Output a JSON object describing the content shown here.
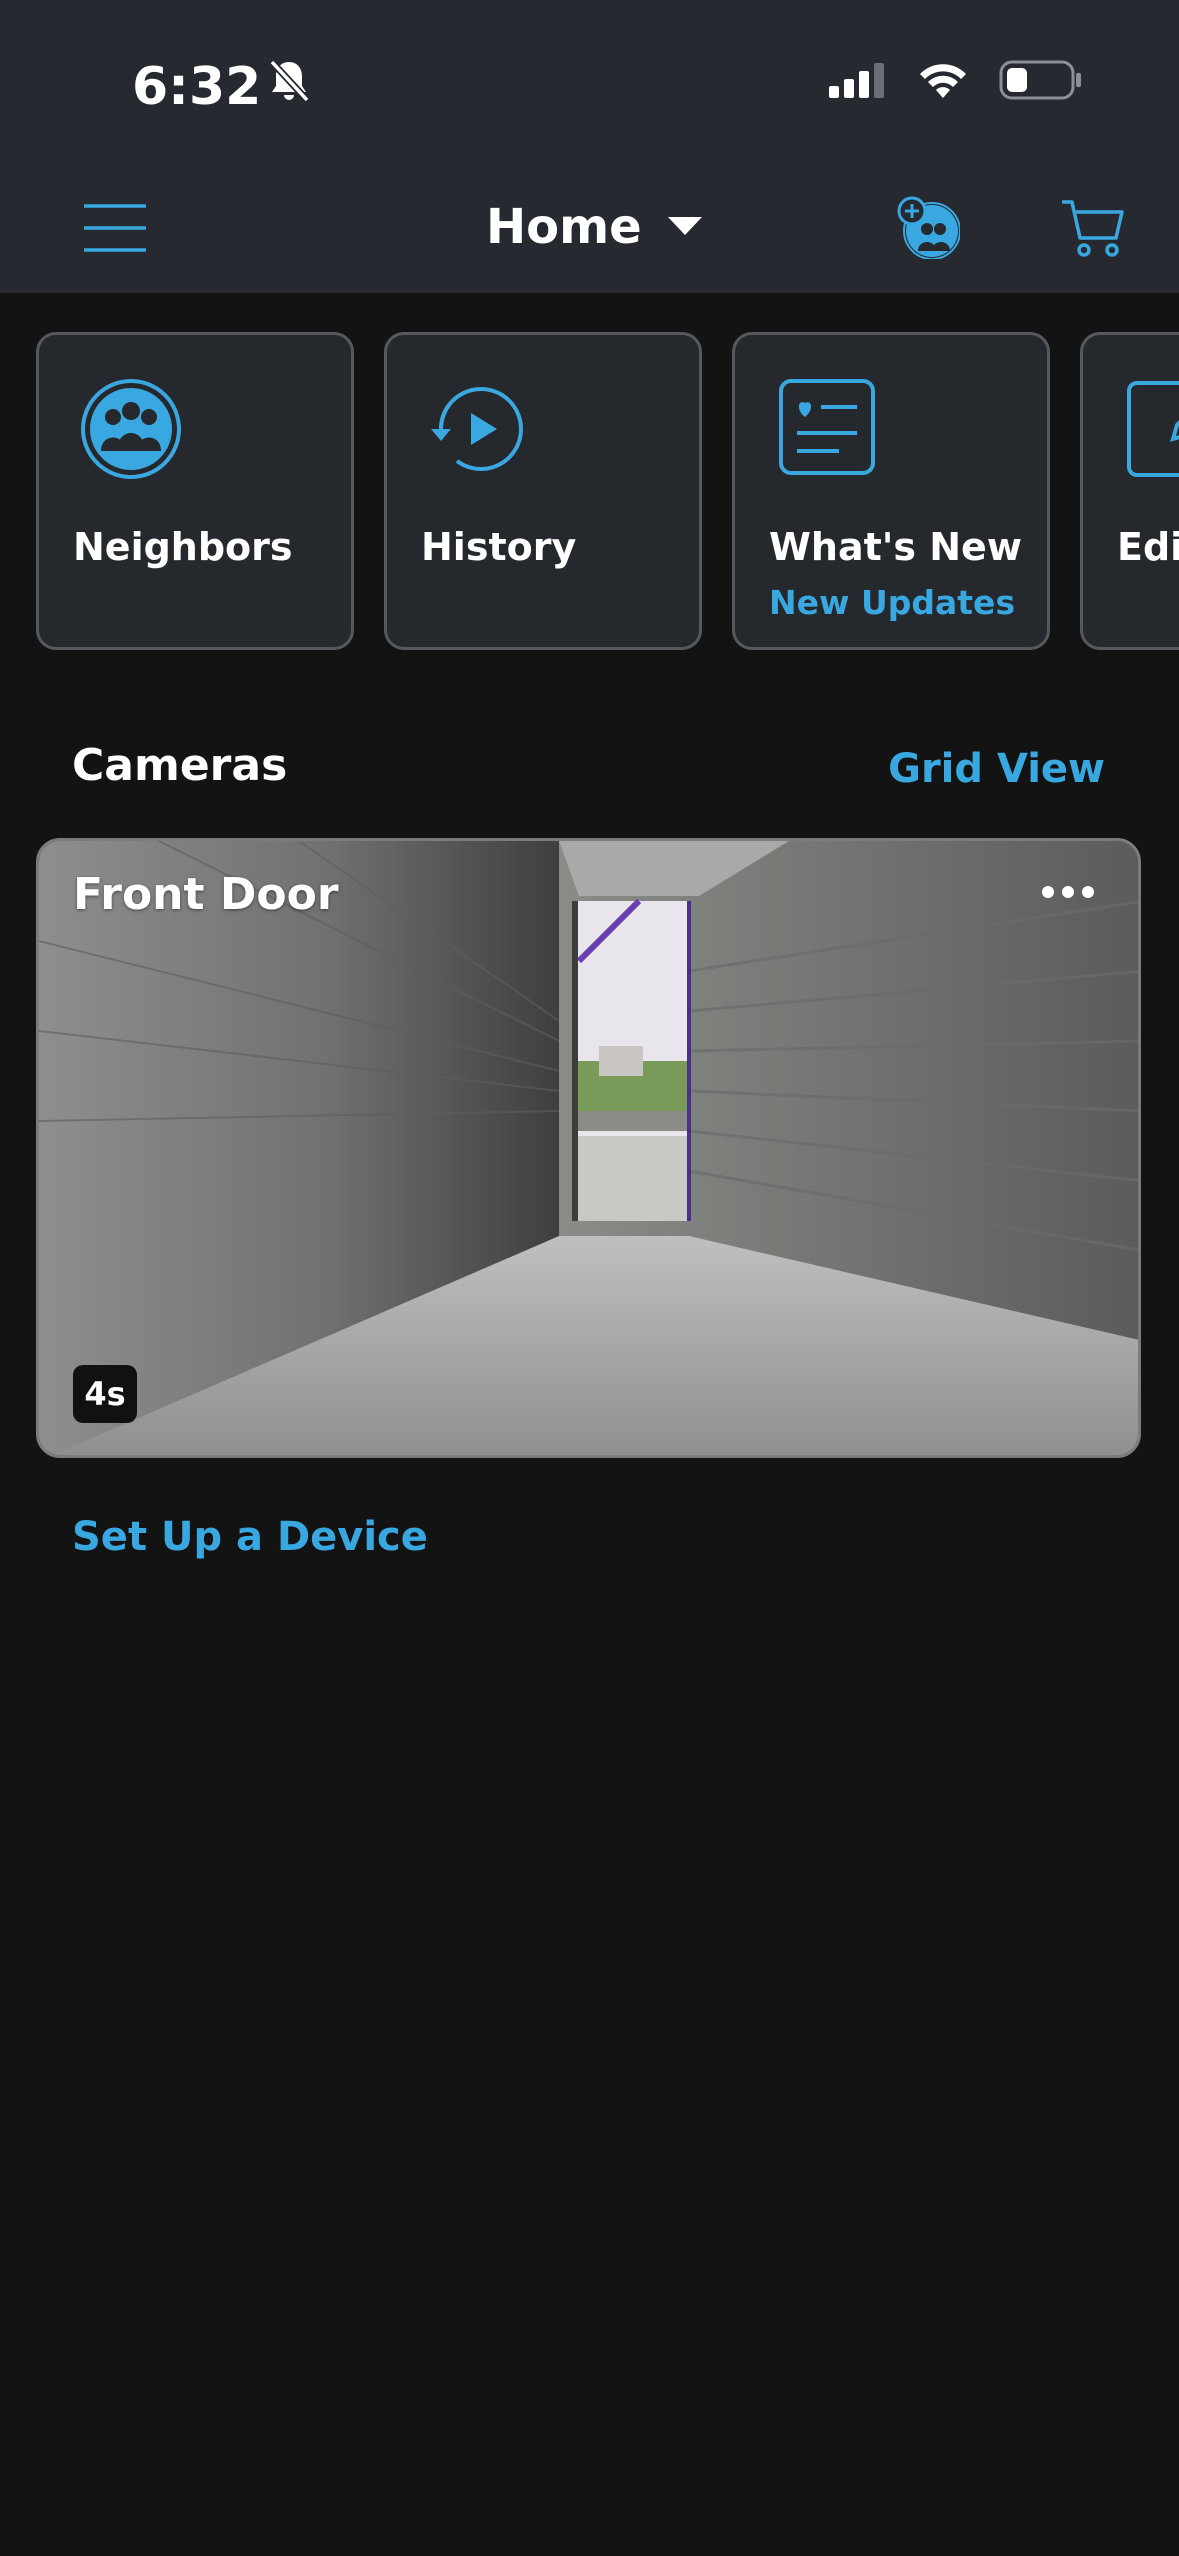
{
  "status_bar": {
    "time": "6:32"
  },
  "header": {
    "location": "Home"
  },
  "tiles": [
    {
      "label": "Neighbors",
      "icon": "neighbors-icon"
    },
    {
      "label": "History",
      "icon": "history-icon"
    },
    {
      "label": "What's New",
      "sub": "New Updates",
      "icon": "whats-new-icon"
    },
    {
      "label": "Edi",
      "icon": "edit-icon"
    }
  ],
  "cameras_section": {
    "title": "Cameras",
    "view_toggle": "Grid View"
  },
  "camera": {
    "name": "Front Door",
    "duration": "4s"
  },
  "setup_link": "Set Up a Device",
  "colors": {
    "accent": "#3aa8e0",
    "header_bg": "#262a30",
    "page_bg": "#131314",
    "tile_bg": "#25282c"
  }
}
